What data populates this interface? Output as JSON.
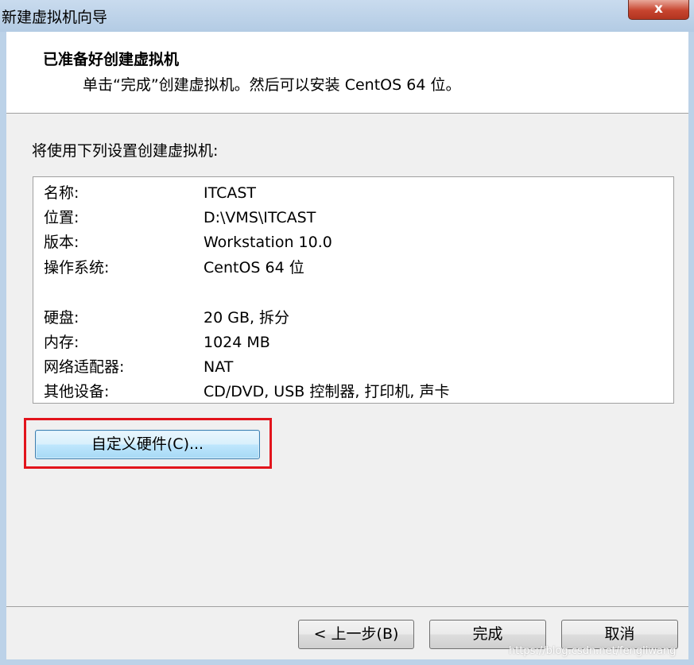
{
  "window": {
    "title": "新建虚拟机向导",
    "close_symbol": "x"
  },
  "header": {
    "title": "已准备好创建虚拟机",
    "subtitle": "单击“完成”创建虚拟机。然后可以安装 CentOS 64 位。"
  },
  "body": {
    "intro": "将使用下列设置创建虚拟机:",
    "summary": [
      {
        "key": "名称:",
        "value": "ITCAST"
      },
      {
        "key": "位置:",
        "value": "D:\\VMS\\ITCAST"
      },
      {
        "key": "版本:",
        "value": "Workstation 10.0"
      },
      {
        "key": "操作系统:",
        "value": "CentOS 64 位"
      },
      {
        "key": "硬盘:",
        "value": "20 GB, 拆分"
      },
      {
        "key": "内存:",
        "value": "1024 MB"
      },
      {
        "key": "网络适配器:",
        "value": "NAT"
      },
      {
        "key": "其他设备:",
        "value": "CD/DVD, USB 控制器, 打印机, 声卡"
      }
    ],
    "customize_button": "自定义硬件(C)..."
  },
  "footer": {
    "back_button": "< 上一步(B)",
    "finish_button": "完成",
    "cancel_button": "取消"
  },
  "watermark": "https://blog.csdn.net/fengliwang",
  "colors": {
    "highlight_border": "#e2141c",
    "title_bar": "#b3cbe4"
  }
}
